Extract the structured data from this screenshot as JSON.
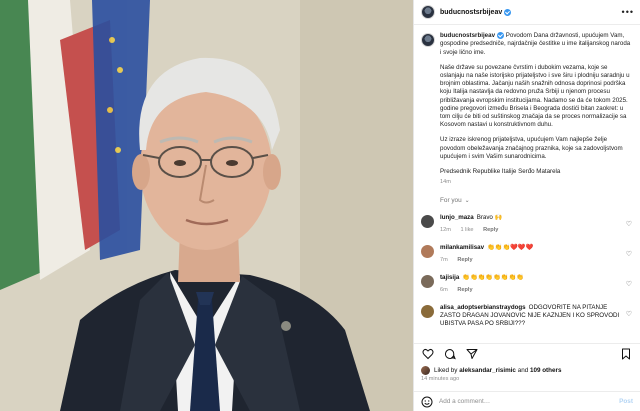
{
  "post": {
    "username": "buducnostsrbijeav",
    "caption": [
      "Povodom Dana državnosti, upućujem Vam, gospodine predsedniče, najrdačnije čestitke u ime italijanskog naroda i svoje lično ime.",
      "Naše države su povezane čvrstim i dubokim vezama, koje se oslanjaju na naše istorijsko prijateljstvo i sve širu i plodniju saradnju u brojnim oblastima. Jačanju naših snažnih odnosa doprinosi podrška koju Italija nastavlja da redovno pruža Srbiji u njenom procesu približavanja evropskim institucijama. Nadamo se da će tokom 2025. godine pregovori između Brisela i Beograda dostići bitan zaokret: u tom cilju će biti od suštinskog značaja da se proces normalizacije sa Kosovom nastavi u konstruktivnom duhu.",
      "Uz izraze iskrenog prijateljstva, upućujem Vam najlepše želje povodom obeležavanja značajnog praznika, koje sa zadovoljstvom upućujem i svim Vašim sunarodnicima.",
      "Predsednik Republike Italije Serđo Matarela"
    ],
    "time": "14m",
    "for_you": "For you",
    "likes_prefix": "Liked by",
    "likes_user": "aleksandar_risimic",
    "likes_and": "and",
    "likes_others": "109 others",
    "posted_ago": "14 minutes ago",
    "add_comment_placeholder": "Add a comment…",
    "post_button": "Post"
  },
  "comments": [
    {
      "user": "lunjo_maza",
      "text": "Bravo 🙌",
      "time": "12m",
      "likes": "1 like",
      "reply": "Reply",
      "avatar_color": "#4a4a4a"
    },
    {
      "user": "milankamilisav",
      "text": "👏👏👏❤️❤️❤️",
      "time": "7m",
      "likes": "",
      "reply": "Reply",
      "avatar_color": "#b07a5a"
    },
    {
      "user": "tajisija",
      "text": "👏👏👏👏👏👏👏👏",
      "time": "6m",
      "likes": "",
      "reply": "Reply",
      "avatar_color": "#7a6a5a"
    },
    {
      "user": "alisa_adoptserbianstraydogs",
      "text": "ODGOVORITE NA PITANJE ZASTO DRAGAN JOVANOVIC NIJE KAZNJEN I KO SPROVODI UBISTVA PASA PO SRBIJI???",
      "time": "",
      "likes": "",
      "reply": "",
      "avatar_color": "#8a6b3a"
    }
  ],
  "icons": {
    "more": "more-options-icon",
    "heart": "heart-icon",
    "comment": "comment-icon",
    "share": "share-icon",
    "save": "bookmark-icon",
    "emoji": "emoji-icon"
  },
  "colors": {
    "verified": "#3897f0",
    "post_button": "#b3d4f4"
  }
}
